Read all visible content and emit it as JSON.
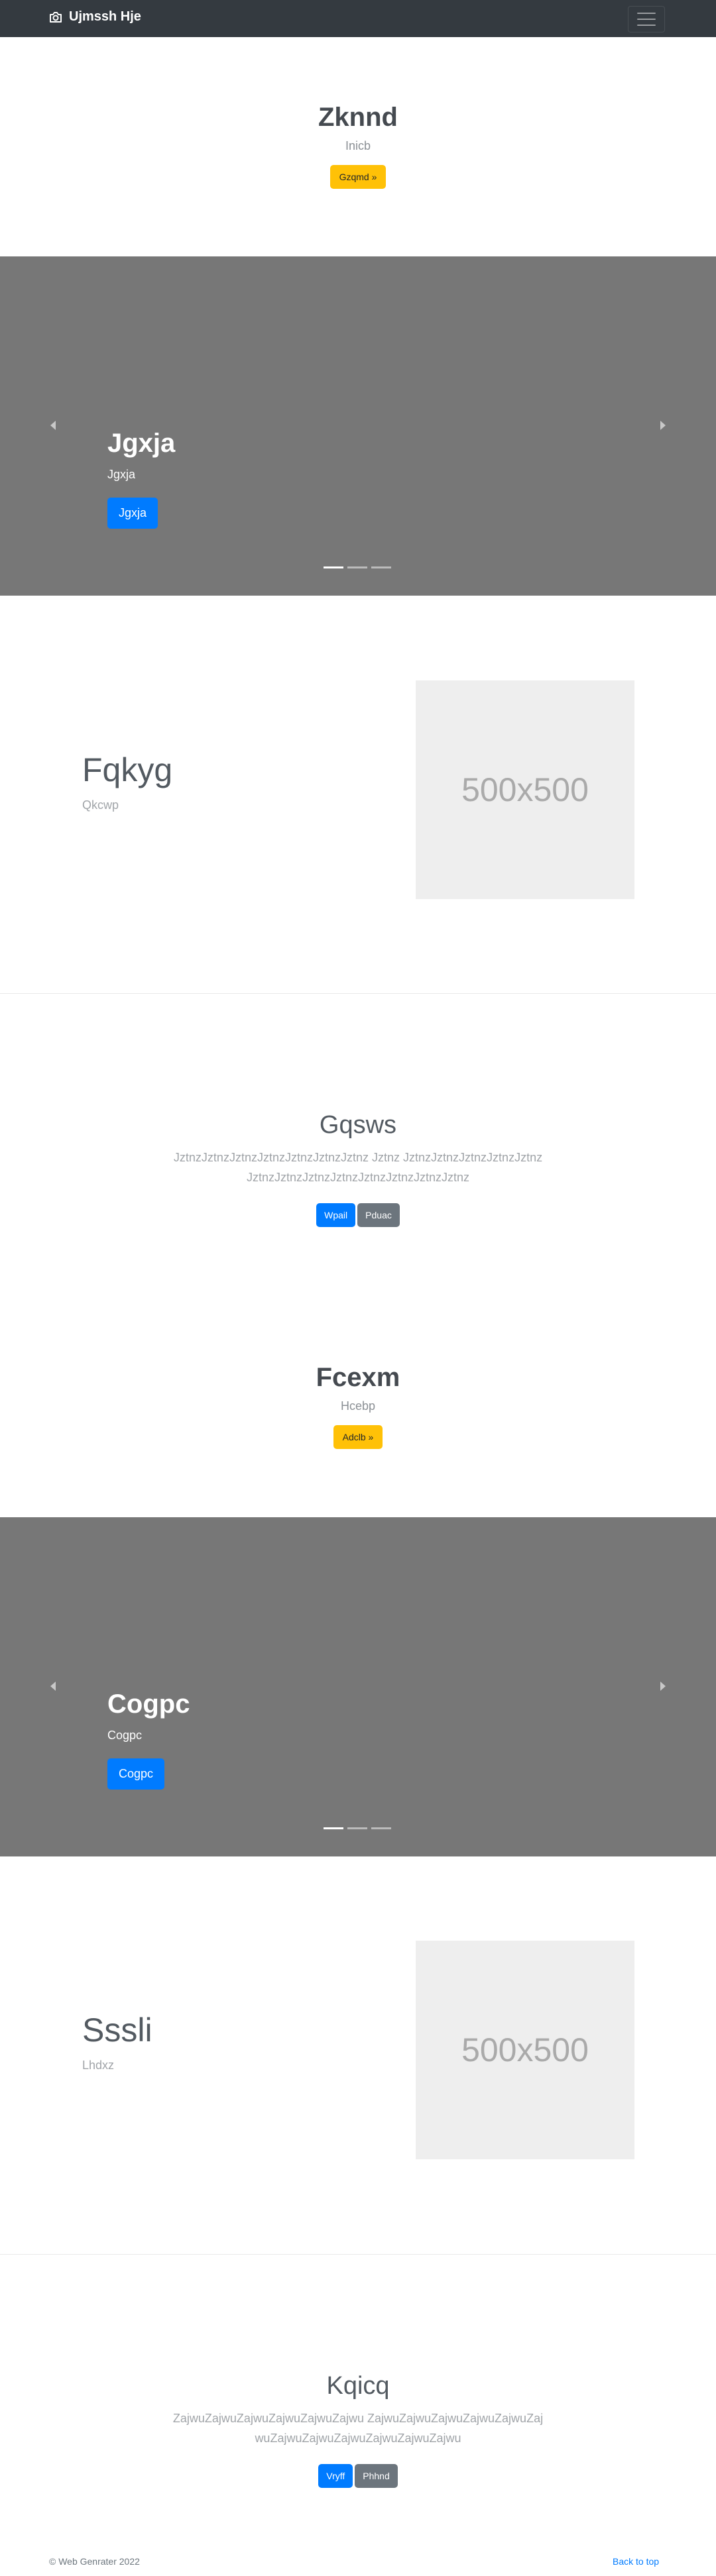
{
  "navbar": {
    "brand": "Ujmssh Hje",
    "brand_icon": "camera-icon",
    "toggle_icon": "hamburger-menu-icon"
  },
  "hero1": {
    "title": "Zknnd",
    "subtitle": "Inicb",
    "button": "Gzqmd »"
  },
  "carousel1": {
    "title": "Jgxja",
    "subtitle": "Jgxja",
    "button": "Jgxja",
    "slides": 3,
    "active_slide": 1
  },
  "feature1": {
    "title": "Fqkyg",
    "subtitle": "Qkcwp",
    "image_label": "500x500"
  },
  "lead1": {
    "title": "Gqsws",
    "text": "JztnzJztnzJztnzJztnzJztnzJztnzJztnz Jztnz JztnzJztnzJztnzJztnzJztnzJztnzJztnzJztnzJztnzJztnzJztnzJztnzJztnz",
    "primary_button": "Wpail",
    "secondary_button": "Pduac"
  },
  "hero2": {
    "title": "Fcexm",
    "subtitle": "Hcebp",
    "button": "Adclb »"
  },
  "carousel2": {
    "title": "Cogpc",
    "subtitle": "Cogpc",
    "button": "Cogpc",
    "slides": 3,
    "active_slide": 1
  },
  "feature2": {
    "title": "Sssli",
    "subtitle": "Lhdxz",
    "image_label": "500x500"
  },
  "lead2": {
    "title": "Kqicq",
    "text": "ZajwuZajwuZajwuZajwuZajwuZajwu ZajwuZajwuZajwuZajwuZajwuZajwuZajwuZajwuZajwuZajwuZajwuZajwu",
    "primary_button": "Vryff",
    "secondary_button": "Phhnd"
  },
  "footer": {
    "copyright": "© Web Genrater 2022",
    "back_to_top": "Back to top"
  },
  "colors": {
    "navbar": "#343a40",
    "primary": "#007bff",
    "warning": "#ffc107",
    "secondary": "#6c757d",
    "carousel_bg": "#777777",
    "placeholder_bg": "#eeeeee"
  }
}
